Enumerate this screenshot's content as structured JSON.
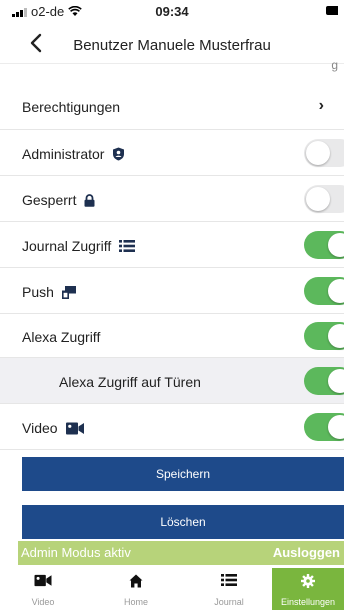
{
  "status_bar": {
    "carrier": "o2-de",
    "time": "09:34"
  },
  "nav": {
    "title": "Benutzer Manuele Musterfrau",
    "back_icon": "chevron-left-icon"
  },
  "settings": {
    "permissions_label": "Berechtigungen",
    "rows": [
      {
        "label": "Administrator",
        "icon": "shield-user-icon",
        "checked": false
      },
      {
        "label": "Gesperrt",
        "icon": "lock-icon",
        "checked": false
      },
      {
        "label": "Journal Zugriff",
        "icon": "list-icon",
        "checked": true
      },
      {
        "label": "Push",
        "icon": "push-window-icon",
        "checked": true
      },
      {
        "label": "Alexa Zugriff",
        "icon": "",
        "checked": true
      },
      {
        "label": "Alexa Zugriff auf Türen",
        "icon": "",
        "checked": true
      },
      {
        "label": "Video",
        "icon": "video-camera-icon",
        "checked": true
      }
    ]
  },
  "actions": {
    "save_label": "Speichern",
    "delete_label": "Löschen"
  },
  "admin_bar": {
    "text": "Admin Modus aktiv",
    "logout_label": "Ausloggen"
  },
  "tabs": [
    {
      "label": "Video",
      "icon": "video-camera-icon",
      "active": false
    },
    {
      "label": "Home",
      "icon": "home-icon",
      "active": false
    },
    {
      "label": "Journal",
      "icon": "list-icon",
      "active": false
    },
    {
      "label": "Einstellungen",
      "icon": "gear-icon",
      "active": true
    }
  ],
  "colors": {
    "toggle_on": "#5cb85c",
    "toggle_off": "#e9e9ea",
    "button": "#1e4a8a",
    "admin_bar": "#b7d37a",
    "active_tab": "#7ab63e"
  }
}
